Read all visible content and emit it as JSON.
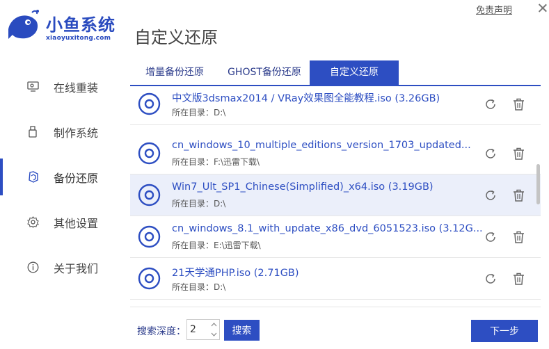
{
  "header": {
    "brand_name": "小鱼系统",
    "brand_url": "xiaoyuxitong.com",
    "page_title": "自定义还原",
    "disclaimer_link": "免责声明"
  },
  "sidebar": {
    "items": [
      {
        "label": "在线重装",
        "icon": "monitor-icon"
      },
      {
        "label": "制作系统",
        "icon": "usb-icon"
      },
      {
        "label": "备份还原",
        "icon": "backup-icon",
        "active": true
      },
      {
        "label": "其他设置",
        "icon": "gear-icon"
      },
      {
        "label": "关于我们",
        "icon": "info-icon"
      }
    ]
  },
  "tabs": [
    {
      "label": "增量备份还原"
    },
    {
      "label": "GHOST备份还原"
    },
    {
      "label": "自定义还原",
      "active": true
    }
  ],
  "files": [
    {
      "name": "中文版3dsmax2014 / VRay效果图全能教程.iso (3.26GB)",
      "dir": "所在目录：D:\\"
    },
    {
      "name": "cn_windows_10_multiple_editions_version_1703_updated...",
      "dir": "所在目录：F:\\迅雷下载\\"
    },
    {
      "name": "Win7_Ult_SP1_Chinese(Simplified)_x64.iso (3.19GB)",
      "dir": "所在目录：D:\\",
      "selected": true
    },
    {
      "name": "cn_windows_8.1_with_update_x86_dvd_6051523.iso (3.12G...",
      "dir": "所在目录：E:\\迅雷下载\\"
    },
    {
      "name": "21天学通PHP.iso (2.71GB)",
      "dir": "所在目录：D:\\"
    }
  ],
  "footer": {
    "depth_label": "搜索深度：",
    "depth_value": "2",
    "search_button": "搜索",
    "next_button": "下一步"
  },
  "colors": {
    "accent": "#2d4ec2",
    "selected_row": "#ebeffa"
  }
}
